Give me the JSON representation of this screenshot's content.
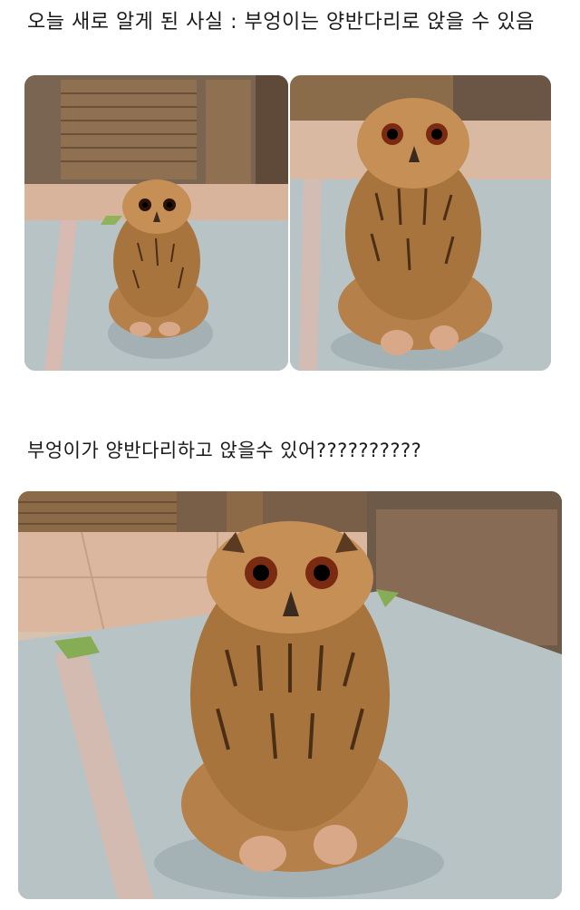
{
  "captions": {
    "top": "오늘 새로 알게 된 사실 : 부엉이는 양반다리로 앉을 수 있음",
    "middle": "부엉이가 양반다리하고 앉을수 있어??????????"
  },
  "photos": [
    {
      "subject": "owl-sitting-far"
    },
    {
      "subject": "owl-sitting-near"
    },
    {
      "subject": "owl-sitting-closeup"
    }
  ],
  "colors": {
    "owl_body": "#b07a3c",
    "owl_face": "#c9904f",
    "owl_eye": "#8a2a12",
    "mat": "#b9c4c6",
    "floor_tile": "#d8b8a0",
    "blind": "#8a6a46",
    "frame": "#6e5a48"
  }
}
